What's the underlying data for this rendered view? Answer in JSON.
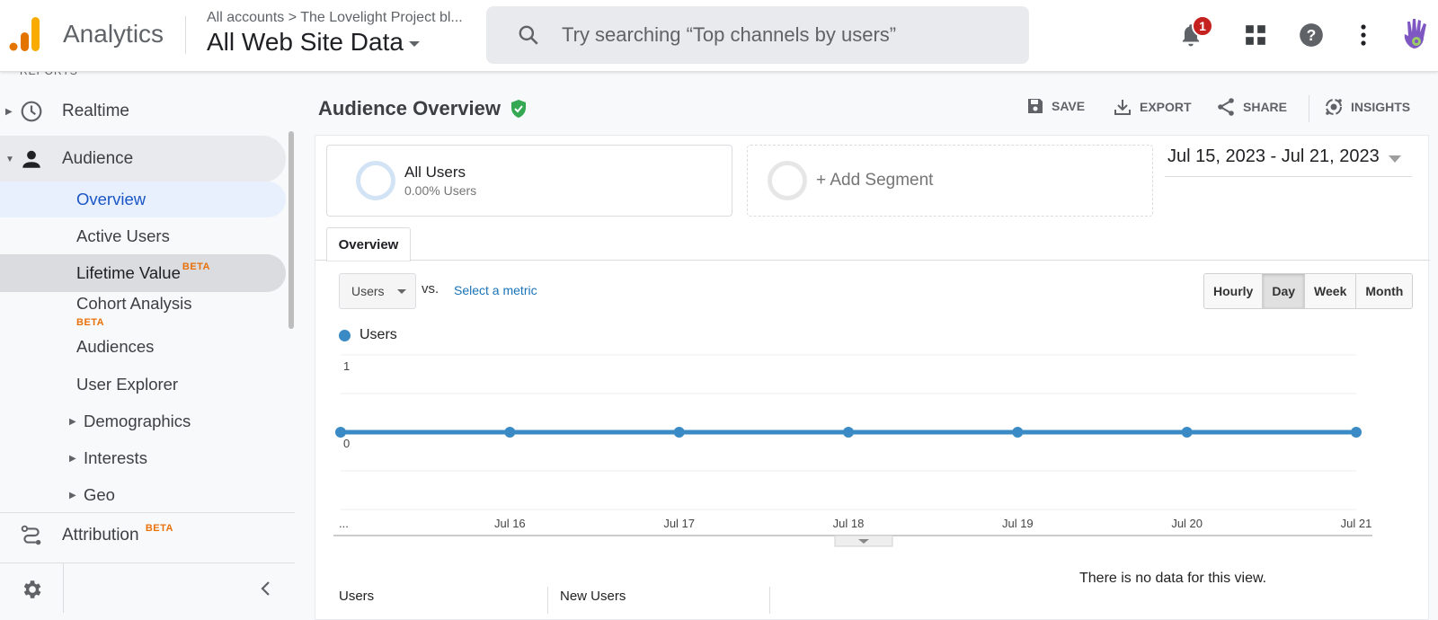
{
  "header": {
    "app_name": "Analytics",
    "breadcrumb": "All accounts > The Lovelight Project bl...",
    "view_name": "All Web Site Data",
    "search_placeholder": "Try searching “Top channels by users”",
    "notification_count": "1",
    "icons": [
      "analytics-logo",
      "search-icon",
      "bell-icon",
      "apps-grid-icon",
      "help-icon",
      "more-vert-icon",
      "avatar-hand"
    ]
  },
  "sidebar": {
    "section_label": "REPORTS",
    "realtime": "Realtime",
    "audience": "Audience",
    "items": [
      {
        "label": "Overview",
        "state": "active"
      },
      {
        "label": "Active Users"
      },
      {
        "label": "Lifetime Value",
        "beta": "BETA",
        "state": "hover"
      },
      {
        "label": "Cohort Analysis",
        "beta": "BETA"
      },
      {
        "label": "Audiences"
      },
      {
        "label": "User Explorer"
      },
      {
        "label": "Demographics",
        "expandable": true
      },
      {
        "label": "Interests",
        "expandable": true
      },
      {
        "label": "Geo",
        "expandable": true
      }
    ],
    "attribution": "Attribution",
    "attribution_beta": "BETA"
  },
  "main": {
    "title": "Audience Overview",
    "actions": {
      "save": "SAVE",
      "export": "EXPORT",
      "share": "SHARE",
      "insights": "INSIGHTS"
    },
    "segments": {
      "all_users": "All Users",
      "all_users_pct": "0.00% Users",
      "add_segment": "+ Add Segment"
    },
    "date_range": "Jul 15, 2023 - Jul 21, 2023",
    "tab": "Overview",
    "metric": "Users",
    "vs": "vs.",
    "select_metric": "Select a metric",
    "periods": [
      "Hourly",
      "Day",
      "Week",
      "Month"
    ],
    "selected_period": "Day",
    "no_data": "There is no data for this view.",
    "kpis": [
      "Users",
      "New Users"
    ]
  },
  "colors": {
    "series": "#3a8bc5",
    "accent_link": "#1a73b8",
    "beta": "#e8710a",
    "verified": "#34a853",
    "badge": "#c5221f"
  },
  "chart_data": {
    "type": "line",
    "title": "",
    "legend": [
      "Users"
    ],
    "legend_position": "top-left",
    "x": [
      "...",
      "Jul 16",
      "Jul 17",
      "Jul 18",
      "Jul 19",
      "Jul 20",
      "Jul 21"
    ],
    "series": [
      {
        "name": "Users",
        "values": [
          0,
          0,
          0,
          0,
          0,
          0,
          0,
          0
        ]
      }
    ],
    "x_points": [
      "Jul 15",
      "Jul 16",
      "Jul 17",
      "Jul 18",
      "Jul 19",
      "Jul 20",
      "Jul 21"
    ],
    "y_ticks": [
      "1",
      "0"
    ],
    "ylim": [
      -1,
      1
    ],
    "grid": true,
    "xlabel": "",
    "ylabel": ""
  }
}
